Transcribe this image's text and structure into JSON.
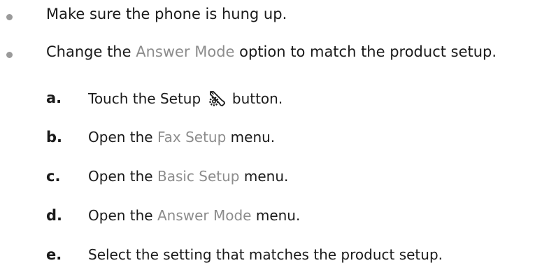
{
  "bullets": [
    {
      "text": "Make sure the phone is hung up."
    },
    {
      "before": "Change the ",
      "ui": "Answer Mode",
      "after": " option to match the product setup."
    }
  ],
  "steps": [
    {
      "letter": "a.",
      "before": "Touch the Setup ",
      "icon": "setup-wrench-gear-icon",
      "after": " button."
    },
    {
      "letter": "b.",
      "before": "Open the ",
      "ui": "Fax Setup",
      "after": " menu."
    },
    {
      "letter": "c.",
      "before": "Open the ",
      "ui": "Basic Setup",
      "after": " menu."
    },
    {
      "letter": "d.",
      "before": "Open the ",
      "ui": "Answer Mode",
      "after": " menu."
    },
    {
      "letter": "e.",
      "text": "Select the setting that matches the product setup."
    }
  ],
  "colors": {
    "ui_term": "#8c8c8c",
    "bullet_dot": "#9a9a9a",
    "text": "#1a1a1a"
  }
}
